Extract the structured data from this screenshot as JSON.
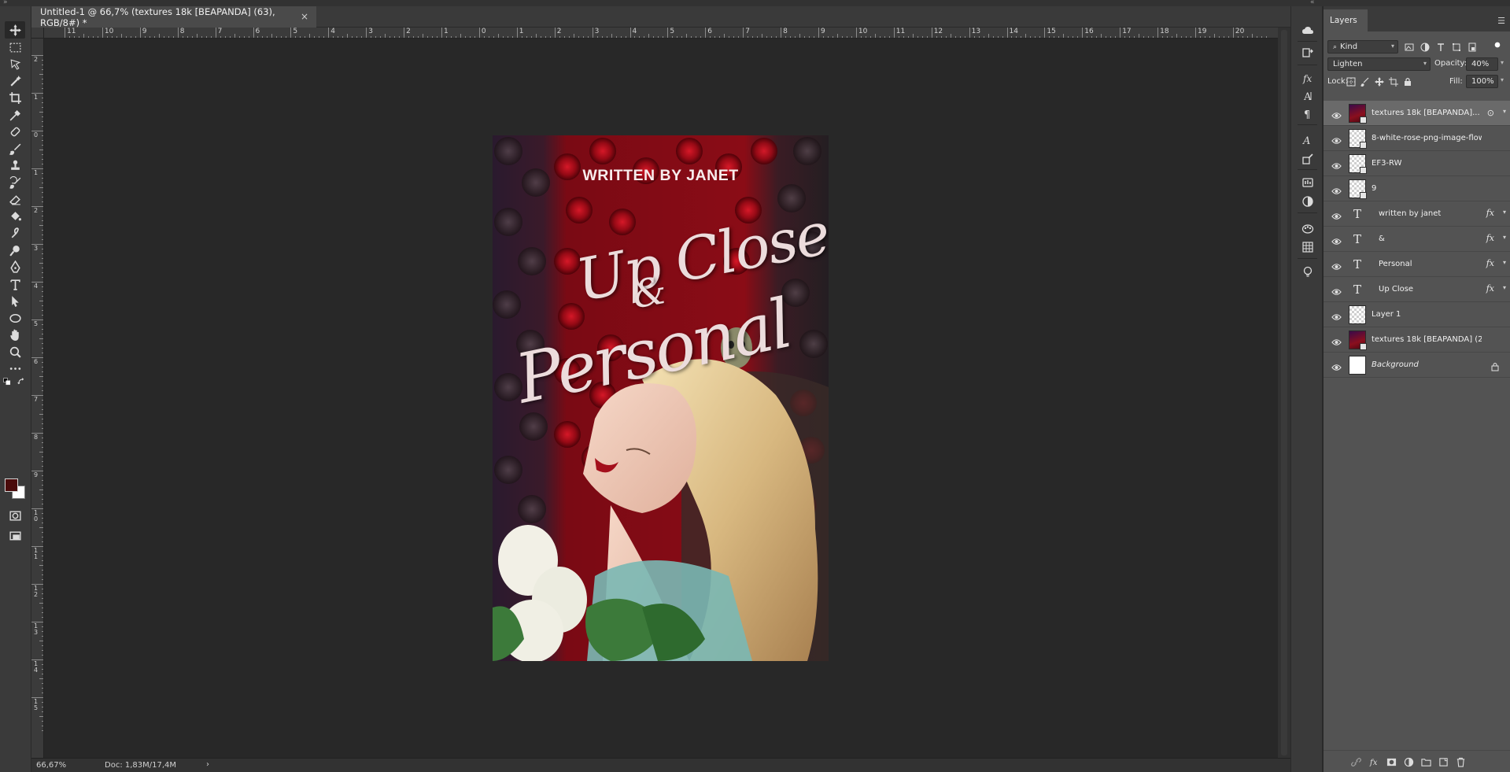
{
  "document_tab": {
    "title": "Untitled-1 @ 66,7% (textures 18k [BEAPANDA] (63), RGB/8#) *",
    "close": "×"
  },
  "rulers": {
    "horizontal_labels": [
      "11",
      "10",
      "9",
      "8",
      "7",
      "6",
      "5",
      "4",
      "3",
      "2",
      "1",
      "0",
      "1",
      "2",
      "3",
      "4",
      "5",
      "6",
      "7",
      "8",
      "9",
      "10",
      "11",
      "12",
      "13",
      "14",
      "15",
      "16",
      "17",
      "18",
      "19",
      "20"
    ],
    "vertical_labels": [
      "2",
      "1",
      "0",
      "1",
      "2",
      "3",
      "4",
      "5",
      "6",
      "7",
      "8",
      "9",
      "10",
      "11",
      "12",
      "13",
      "14",
      "15"
    ]
  },
  "artwork": {
    "byline": "WRITTEN BY JANET",
    "title_line1": "Up Close",
    "ampersand": "&",
    "title_line2": "Personal"
  },
  "status": {
    "zoom": "66,67%",
    "doc_size": "Doc: 1,83M/17,4M",
    "arrow": "›"
  },
  "layers_panel": {
    "tab_label": "Layers",
    "filter_kind": "Kind",
    "blend_mode": "Lighten",
    "opacity_label": "Opacity:",
    "opacity_value": "40%",
    "lock_label": "Lock:",
    "fill_label": "Fill:",
    "fill_value": "100%",
    "layers": [
      {
        "name": "textures 18k [BEAPANDA]...",
        "kind": "texture",
        "selected": true,
        "smart": true,
        "linked": true
      },
      {
        "name": "8-white-rose-png-image-flow...",
        "kind": "checker",
        "smart": true
      },
      {
        "name": "EF3-RW",
        "kind": "checker",
        "smart": true
      },
      {
        "name": "9",
        "kind": "checker",
        "smart": true
      },
      {
        "name": "written by janet",
        "kind": "text",
        "fx": "fx"
      },
      {
        "name": "&",
        "kind": "text",
        "fx": "fx"
      },
      {
        "name": "Personal",
        "kind": "text",
        "fx": "fx"
      },
      {
        "name": "Up Close",
        "kind": "text",
        "fx": "fx"
      },
      {
        "name": "Layer 1",
        "kind": "checker"
      },
      {
        "name": "textures 18k [BEAPANDA] (2...",
        "kind": "texture",
        "smart": true
      },
      {
        "name": "Background",
        "kind": "white",
        "locked": true
      }
    ]
  },
  "colors": {
    "foreground": "#4a0b0b",
    "background": "#ffffff"
  }
}
